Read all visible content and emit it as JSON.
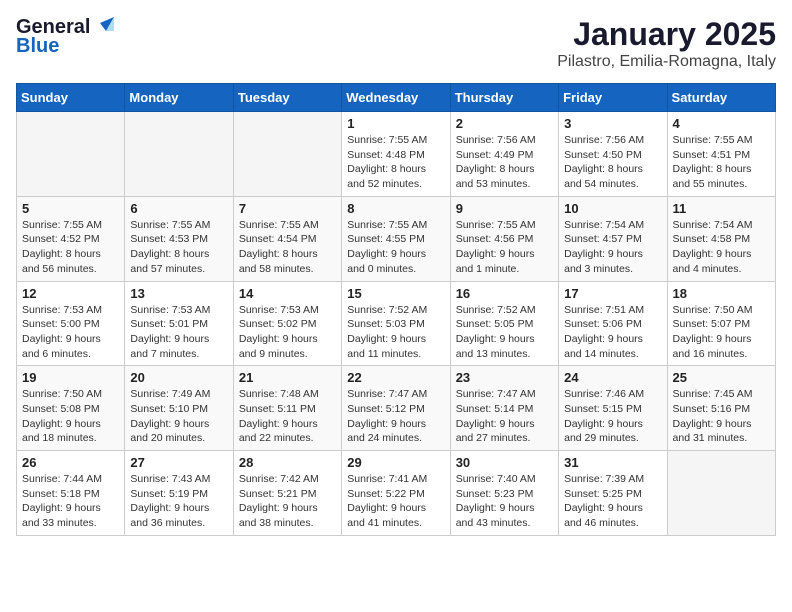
{
  "logo": {
    "line1": "General",
    "line2": "Blue"
  },
  "title": "January 2025",
  "location": "Pilastro, Emilia-Romagna, Italy",
  "headers": [
    "Sunday",
    "Monday",
    "Tuesday",
    "Wednesday",
    "Thursday",
    "Friday",
    "Saturday"
  ],
  "weeks": [
    [
      {
        "day": "",
        "info": ""
      },
      {
        "day": "",
        "info": ""
      },
      {
        "day": "",
        "info": ""
      },
      {
        "day": "1",
        "info": "Sunrise: 7:55 AM\nSunset: 4:48 PM\nDaylight: 8 hours and 52 minutes."
      },
      {
        "day": "2",
        "info": "Sunrise: 7:56 AM\nSunset: 4:49 PM\nDaylight: 8 hours and 53 minutes."
      },
      {
        "day": "3",
        "info": "Sunrise: 7:56 AM\nSunset: 4:50 PM\nDaylight: 8 hours and 54 minutes."
      },
      {
        "day": "4",
        "info": "Sunrise: 7:55 AM\nSunset: 4:51 PM\nDaylight: 8 hours and 55 minutes."
      }
    ],
    [
      {
        "day": "5",
        "info": "Sunrise: 7:55 AM\nSunset: 4:52 PM\nDaylight: 8 hours and 56 minutes."
      },
      {
        "day": "6",
        "info": "Sunrise: 7:55 AM\nSunset: 4:53 PM\nDaylight: 8 hours and 57 minutes."
      },
      {
        "day": "7",
        "info": "Sunrise: 7:55 AM\nSunset: 4:54 PM\nDaylight: 8 hours and 58 minutes."
      },
      {
        "day": "8",
        "info": "Sunrise: 7:55 AM\nSunset: 4:55 PM\nDaylight: 9 hours and 0 minutes."
      },
      {
        "day": "9",
        "info": "Sunrise: 7:55 AM\nSunset: 4:56 PM\nDaylight: 9 hours and 1 minute."
      },
      {
        "day": "10",
        "info": "Sunrise: 7:54 AM\nSunset: 4:57 PM\nDaylight: 9 hours and 3 minutes."
      },
      {
        "day": "11",
        "info": "Sunrise: 7:54 AM\nSunset: 4:58 PM\nDaylight: 9 hours and 4 minutes."
      }
    ],
    [
      {
        "day": "12",
        "info": "Sunrise: 7:53 AM\nSunset: 5:00 PM\nDaylight: 9 hours and 6 minutes."
      },
      {
        "day": "13",
        "info": "Sunrise: 7:53 AM\nSunset: 5:01 PM\nDaylight: 9 hours and 7 minutes."
      },
      {
        "day": "14",
        "info": "Sunrise: 7:53 AM\nSunset: 5:02 PM\nDaylight: 9 hours and 9 minutes."
      },
      {
        "day": "15",
        "info": "Sunrise: 7:52 AM\nSunset: 5:03 PM\nDaylight: 9 hours and 11 minutes."
      },
      {
        "day": "16",
        "info": "Sunrise: 7:52 AM\nSunset: 5:05 PM\nDaylight: 9 hours and 13 minutes."
      },
      {
        "day": "17",
        "info": "Sunrise: 7:51 AM\nSunset: 5:06 PM\nDaylight: 9 hours and 14 minutes."
      },
      {
        "day": "18",
        "info": "Sunrise: 7:50 AM\nSunset: 5:07 PM\nDaylight: 9 hours and 16 minutes."
      }
    ],
    [
      {
        "day": "19",
        "info": "Sunrise: 7:50 AM\nSunset: 5:08 PM\nDaylight: 9 hours and 18 minutes."
      },
      {
        "day": "20",
        "info": "Sunrise: 7:49 AM\nSunset: 5:10 PM\nDaylight: 9 hours and 20 minutes."
      },
      {
        "day": "21",
        "info": "Sunrise: 7:48 AM\nSunset: 5:11 PM\nDaylight: 9 hours and 22 minutes."
      },
      {
        "day": "22",
        "info": "Sunrise: 7:47 AM\nSunset: 5:12 PM\nDaylight: 9 hours and 24 minutes."
      },
      {
        "day": "23",
        "info": "Sunrise: 7:47 AM\nSunset: 5:14 PM\nDaylight: 9 hours and 27 minutes."
      },
      {
        "day": "24",
        "info": "Sunrise: 7:46 AM\nSunset: 5:15 PM\nDaylight: 9 hours and 29 minutes."
      },
      {
        "day": "25",
        "info": "Sunrise: 7:45 AM\nSunset: 5:16 PM\nDaylight: 9 hours and 31 minutes."
      }
    ],
    [
      {
        "day": "26",
        "info": "Sunrise: 7:44 AM\nSunset: 5:18 PM\nDaylight: 9 hours and 33 minutes."
      },
      {
        "day": "27",
        "info": "Sunrise: 7:43 AM\nSunset: 5:19 PM\nDaylight: 9 hours and 36 minutes."
      },
      {
        "day": "28",
        "info": "Sunrise: 7:42 AM\nSunset: 5:21 PM\nDaylight: 9 hours and 38 minutes."
      },
      {
        "day": "29",
        "info": "Sunrise: 7:41 AM\nSunset: 5:22 PM\nDaylight: 9 hours and 41 minutes."
      },
      {
        "day": "30",
        "info": "Sunrise: 7:40 AM\nSunset: 5:23 PM\nDaylight: 9 hours and 43 minutes."
      },
      {
        "day": "31",
        "info": "Sunrise: 7:39 AM\nSunset: 5:25 PM\nDaylight: 9 hours and 46 minutes."
      },
      {
        "day": "",
        "info": ""
      }
    ]
  ]
}
